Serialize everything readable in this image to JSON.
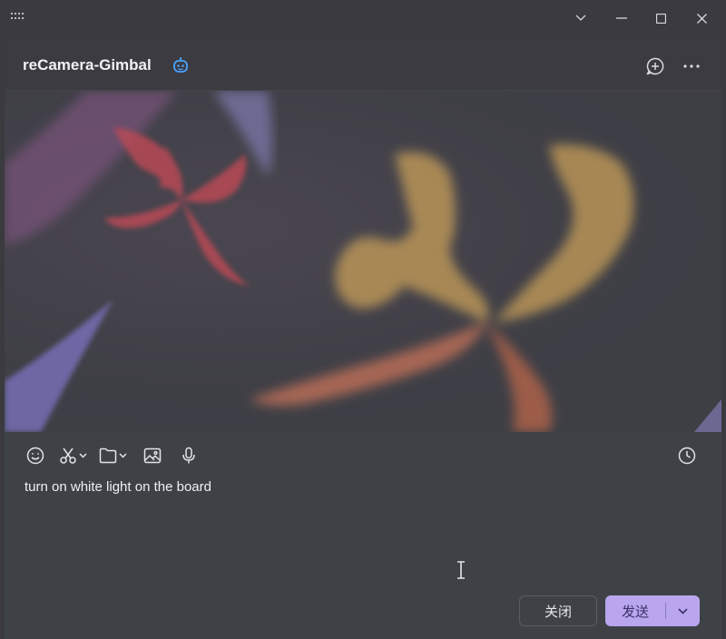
{
  "window": {
    "controls": [
      "menu-grip",
      "chevron-down",
      "minimize",
      "maximize",
      "close"
    ]
  },
  "header": {
    "title": "reCamera-Gimbal",
    "title_icon": "bot-icon",
    "actions": [
      "add-chat-icon",
      "more-icon"
    ]
  },
  "composer": {
    "toolbar": [
      "emoji-icon",
      "scissors-icon",
      "folder-icon",
      "image-icon",
      "microphone-icon",
      "history-icon"
    ],
    "input_value": "turn on white light on the board",
    "close_label": "关闭",
    "send_label": "发送"
  },
  "colors": {
    "accent": "#b9a6ef",
    "bot_icon": "#4aa3ff",
    "background": "#3e4247"
  }
}
